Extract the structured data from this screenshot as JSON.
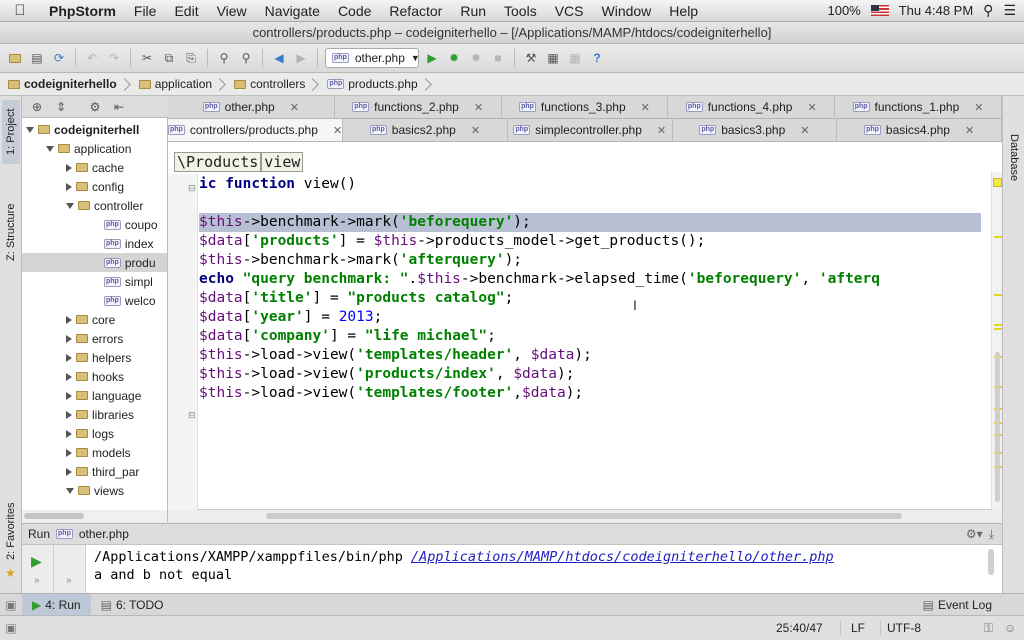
{
  "menubar": {
    "app": "PhpStorm",
    "items": [
      "File",
      "Edit",
      "View",
      "Navigate",
      "Code",
      "Refactor",
      "Run",
      "Tools",
      "VCS",
      "Window",
      "Help"
    ],
    "battery": "100%",
    "clock": "Thu 4:48 PM"
  },
  "window": {
    "title": "controllers/products.php – codeigniterhello – [/Applications/MAMP/htdocs/codeigniterhello]"
  },
  "toolbar": {
    "run_config": "other.php"
  },
  "breadcrumb": [
    "codeigniterhello",
    "application",
    "controllers",
    "products.php"
  ],
  "left_strip": {
    "project": "1: Project",
    "structure": "Z: Structure",
    "favorites": "2: Favorites"
  },
  "right_strip": {
    "database": "Database"
  },
  "tree": {
    "root": "codeigniterhell",
    "application": "application",
    "items": [
      {
        "label": "cache",
        "type": "folder",
        "indent": 2,
        "state": "closed"
      },
      {
        "label": "config",
        "type": "folder",
        "indent": 2,
        "state": "closed"
      },
      {
        "label": "controller",
        "type": "folder",
        "indent": 2,
        "state": "open"
      },
      {
        "label": "coupo",
        "type": "php",
        "indent": 3
      },
      {
        "label": "index",
        "type": "php",
        "indent": 3
      },
      {
        "label": "produ",
        "type": "php",
        "indent": 3,
        "selected": true
      },
      {
        "label": "simpl",
        "type": "php",
        "indent": 3
      },
      {
        "label": "welco",
        "type": "php",
        "indent": 3
      },
      {
        "label": "core",
        "type": "folder",
        "indent": 2,
        "state": "closed"
      },
      {
        "label": "errors",
        "type": "folder",
        "indent": 2,
        "state": "closed"
      },
      {
        "label": "helpers",
        "type": "folder",
        "indent": 2,
        "state": "closed"
      },
      {
        "label": "hooks",
        "type": "folder",
        "indent": 2,
        "state": "closed"
      },
      {
        "label": "language",
        "type": "folder",
        "indent": 2,
        "state": "closed"
      },
      {
        "label": "libraries",
        "type": "folder",
        "indent": 2,
        "state": "closed"
      },
      {
        "label": "logs",
        "type": "folder",
        "indent": 2,
        "state": "closed"
      },
      {
        "label": "models",
        "type": "folder",
        "indent": 2,
        "state": "closed"
      },
      {
        "label": "third_par",
        "type": "folder",
        "indent": 2,
        "state": "closed"
      },
      {
        "label": "views",
        "type": "folder",
        "indent": 2,
        "state": "open"
      }
    ]
  },
  "tabs_row1": [
    "other.php",
    "functions_2.php",
    "functions_3.php",
    "functions_4.php",
    "functions_1.php"
  ],
  "tabs_row2": [
    "controllers/products.php",
    "basics2.php",
    "simplecontroller.php",
    "basics3.php",
    "basics4.php"
  ],
  "editor": {
    "nav": [
      "\\Products",
      "view"
    ],
    "lines": [
      "ic function view()",
      "",
      "$this->benchmark->mark('beforequery');",
      "$data['products'] = $this->products_model->get_products();",
      "$this->benchmark->mark('afterquery');",
      "echo \"query benchmark: \".$this->benchmark->elapsed_time('beforequery', 'afterq",
      "$data['title'] = \"products catalog\";",
      "$data['year'] = 2013;",
      "$data['company'] = \"life michael\";",
      "$this->load->view('templates/header', $data);",
      "$this->load->view('products/index', $data);",
      "$this->load->view('templates/footer',$data);"
    ]
  },
  "run": {
    "label": "Run",
    "file": "other.php",
    "cmd": "/Applications/XAMPP/xamppfiles/bin/php ",
    "link": "/Applications/MAMP/htdocs/codeigniterhello/other.php",
    "line2": "a and b not equal"
  },
  "bottom_tabs": {
    "run": "4: Run",
    "todo": "6: TODO",
    "event_log": "Event Log"
  },
  "status": {
    "position": "25:40/47",
    "line_sep": "LF",
    "encoding": "UTF-8"
  }
}
